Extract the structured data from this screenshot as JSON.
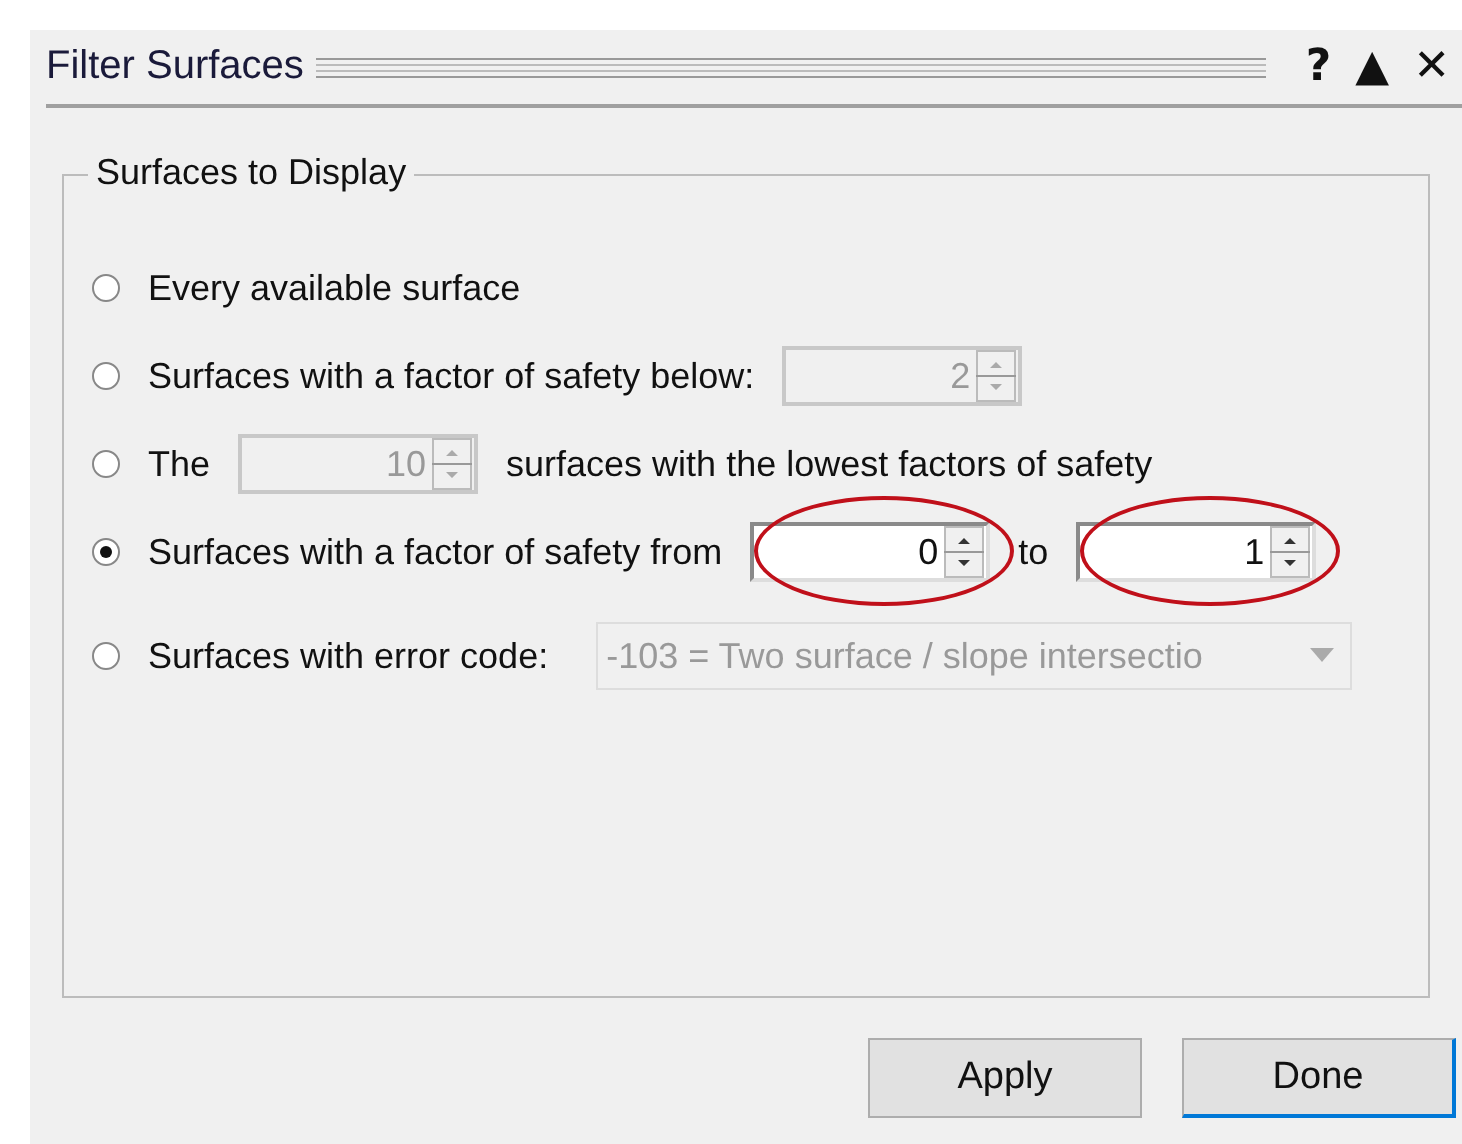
{
  "window": {
    "title": "Filter Surfaces",
    "title_buttons": [
      "?",
      "▲",
      "✕"
    ]
  },
  "group": {
    "title": "Surfaces to Display",
    "options": [
      {
        "selected": false,
        "parts": [
          {
            "kind": "text",
            "text": "Every available surface"
          }
        ]
      },
      {
        "selected": false,
        "parts": [
          {
            "kind": "text",
            "text": "Surfaces with a factor of safety below:"
          },
          {
            "kind": "spin",
            "value": "2",
            "disabled": true,
            "highlighted": false
          }
        ]
      },
      {
        "selected": false,
        "parts": [
          {
            "kind": "text",
            "text": "The"
          },
          {
            "kind": "spin",
            "value": "10",
            "disabled": true,
            "highlighted": false
          },
          {
            "kind": "text",
            "text": "surfaces with the lowest factors of safety"
          }
        ]
      },
      {
        "selected": true,
        "parts": [
          {
            "kind": "text",
            "text": "Surfaces with a factor of safety from"
          },
          {
            "kind": "spin",
            "value": "0",
            "disabled": false,
            "highlighted": true
          },
          {
            "kind": "text",
            "text": "to"
          },
          {
            "kind": "spin",
            "value": "1",
            "disabled": false,
            "highlighted": true
          }
        ]
      },
      {
        "selected": false,
        "parts": [
          {
            "kind": "text",
            "text": "Surfaces with error code:"
          },
          {
            "kind": "dropdown",
            "value": "-103 = Two surface / slope intersectio",
            "disabled": true
          }
        ]
      }
    ]
  },
  "buttons": [
    {
      "label": "Apply",
      "default": false
    },
    {
      "label": "Done",
      "default": true
    }
  ]
}
